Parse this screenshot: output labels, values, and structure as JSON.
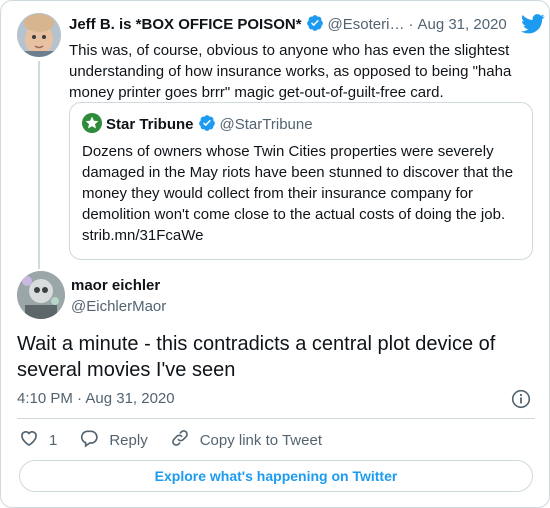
{
  "parent": {
    "name": "Jeff B. is *BOX OFFICE POISON*",
    "handle": "@Esoteri…",
    "date": "Aug 31, 2020",
    "text": "This was, of course, obvious to anyone who has even the slightest understanding of how insurance works, as opposed to being \"haha money printer goes brrr\" magic get-out-of-guilt-free card."
  },
  "quote": {
    "name": "Star Tribune",
    "handle": "@StarTribune",
    "text": "Dozens of owners whose Twin Cities properties were severely damaged in the May riots have been stunned to discover that the money they would collect from their insurance company for demolition won't come close to the actual costs of doing the job. strib.mn/31FcaWe"
  },
  "reply": {
    "name": "maor eichler",
    "handle": "@EichlerMaor",
    "text": "Wait a minute - this contradicts a central plot device of several movies I've seen",
    "time": "4:10 PM · Aug 31, 2020"
  },
  "actions": {
    "like_count": "1",
    "reply_label": "Reply",
    "copy_label": "Copy link to Tweet"
  },
  "explore_label": "Explore what's happening on Twitter",
  "colors": {
    "accent": "#1d9bf0",
    "muted": "#536471",
    "border": "#cfd9de",
    "startribune": "#2e8b3a"
  },
  "icons": {
    "verified": "verified-badge-icon",
    "bird": "twitter-bird-icon",
    "info": "info-icon",
    "like": "heart-icon",
    "reply": "reply-bubble-icon",
    "copy": "link-icon"
  }
}
